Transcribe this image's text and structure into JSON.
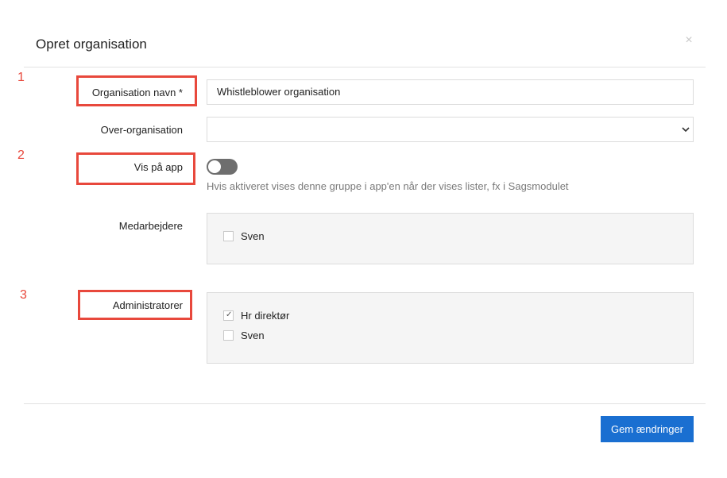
{
  "dialog": {
    "title": "Opret organisation",
    "close_glyph": "×"
  },
  "annotations": [
    "1",
    "2",
    "3"
  ],
  "form": {
    "org_name": {
      "label": "Organisation navn *",
      "value": "Whistleblower organisation"
    },
    "parent_org": {
      "label": "Over-organisation",
      "value": ""
    },
    "show_on_app": {
      "label": "Vis på app",
      "enabled": false,
      "help": "Hvis aktiveret vises denne gruppe i app'en når der vises lister, fx i Sagsmodulet"
    },
    "employees": {
      "label": "Medarbejdere",
      "options": [
        {
          "name": "Sven",
          "checked": false
        }
      ]
    },
    "administrators": {
      "label": "Administratorer",
      "options": [
        {
          "name": "Hr direktør",
          "checked": true
        },
        {
          "name": "Sven",
          "checked": false
        }
      ]
    }
  },
  "footer": {
    "save_label": "Gem ændringer"
  },
  "colors": {
    "accent": "#1a6fd1",
    "annotation": "#e8483c",
    "toggle_off": "#6e6e6e"
  }
}
